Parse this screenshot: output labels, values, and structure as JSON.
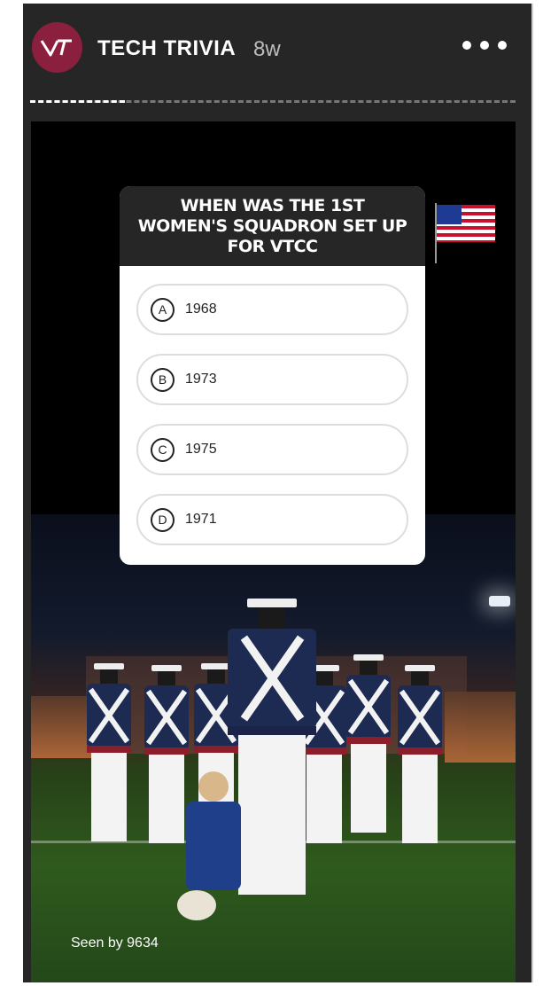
{
  "header": {
    "account_name": "TECH TRIVIA",
    "post_age": "8w",
    "avatar_icon": "vt-logo-icon",
    "more_icon": "more-options-icon"
  },
  "progress": {
    "segments": 5,
    "active_segment": 1
  },
  "quiz": {
    "question": "WHEN WAS THE 1ST WOMEN'S SQUADRON SET UP FOR VTCC",
    "options": [
      {
        "letter": "A",
        "text": "1968"
      },
      {
        "letter": "B",
        "text": "1973"
      },
      {
        "letter": "C",
        "text": "1975"
      },
      {
        "letter": "D",
        "text": "1971"
      }
    ]
  },
  "stickers": {
    "flag": "us-flag-icon"
  },
  "footer": {
    "seen_by": "Seen by 9634"
  },
  "colors": {
    "avatar_bg": "#8b1f3e",
    "header_bg": "#262626",
    "story_bg": "#000000"
  }
}
